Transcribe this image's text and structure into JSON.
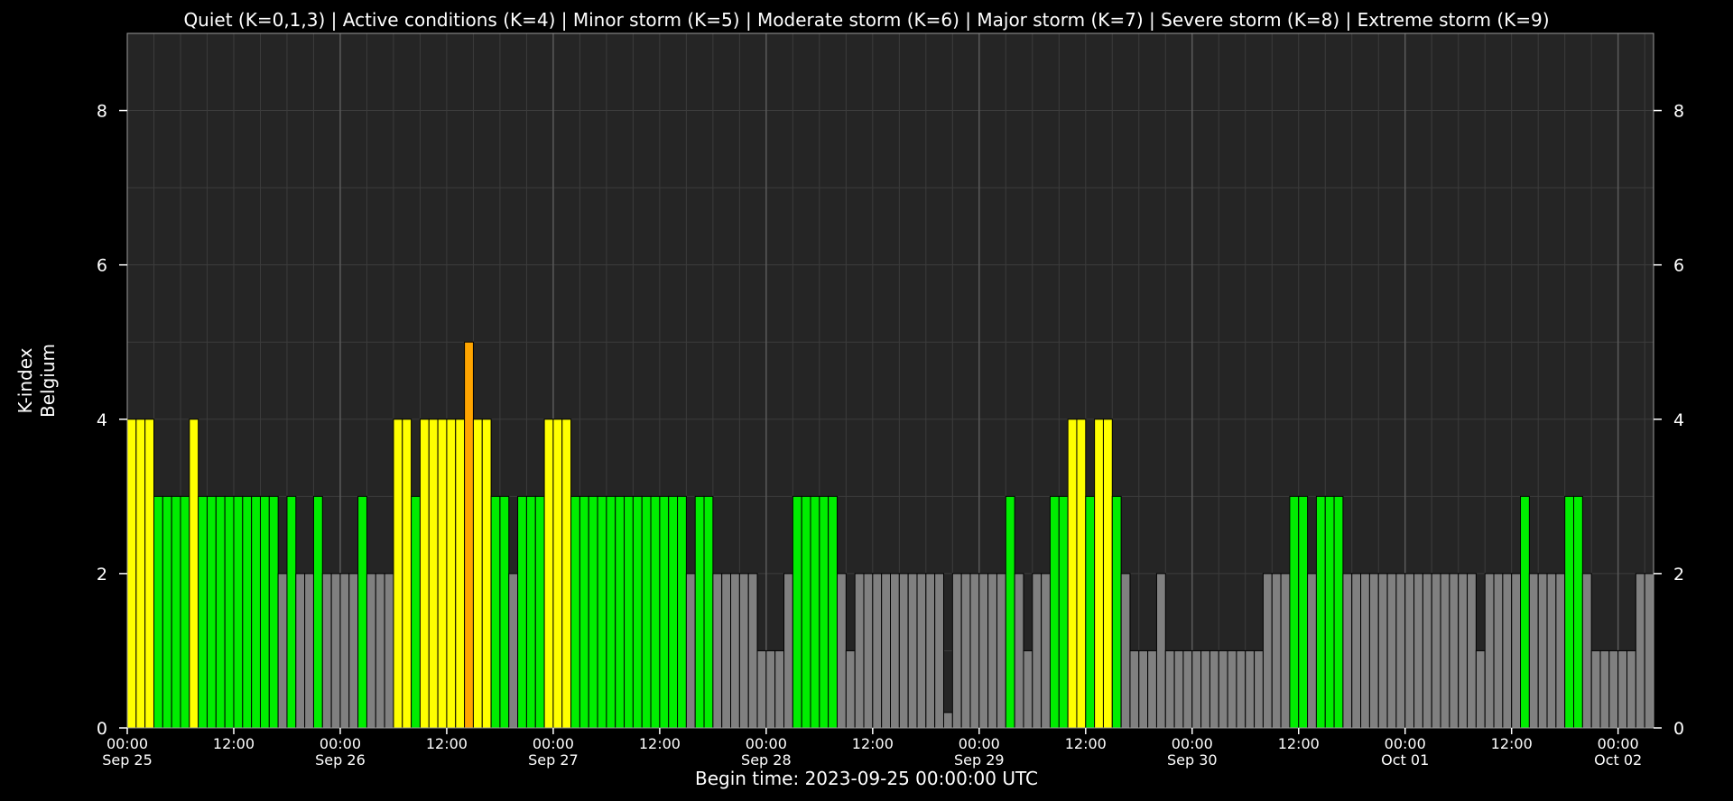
{
  "colors": {
    "background": "#000000",
    "plot_background": "#252525",
    "grid": "#3c3c3c",
    "day_line": "#5a5a5a",
    "quiet": "#808080",
    "quiet_k3": "#00ee00",
    "active": "#ffff00",
    "minor_storm": "#ffa500",
    "bar_edge": "#000000"
  },
  "chart_data": {
    "type": "bar",
    "title": "Quiet (K=0,1,3) | Active conditions (K=4) | Minor storm (K=5) | Moderate storm (K=6) | Major storm (K=7) | Severe storm (K=8) | Extreme storm (K=9)",
    "ylabel_line1": "K-index",
    "ylabel_line2": "Belgium",
    "xlabel": "Begin time: 2023-09-25 00:00:00 UTC",
    "ylim": [
      0,
      9
    ],
    "yticks": [
      0,
      2,
      4,
      6,
      8
    ],
    "interval": "1 hour",
    "x_range": [
      "2023-09-25 00:00",
      "2023-10-02 00:00"
    ],
    "grid": true,
    "xticks": [
      {
        "time": "00:00",
        "date": "Sep 25"
      },
      {
        "time": "12:00",
        "date": ""
      },
      {
        "time": "00:00",
        "date": "Sep 26"
      },
      {
        "time": "12:00",
        "date": ""
      },
      {
        "time": "00:00",
        "date": "Sep 27"
      },
      {
        "time": "12:00",
        "date": ""
      },
      {
        "time": "00:00",
        "date": "Sep 28"
      },
      {
        "time": "12:00",
        "date": ""
      },
      {
        "time": "00:00",
        "date": "Sep 29"
      },
      {
        "time": "12:00",
        "date": ""
      },
      {
        "time": "00:00",
        "date": "Sep 30"
      },
      {
        "time": "12:00",
        "date": ""
      },
      {
        "time": "00:00",
        "date": "Oct 01"
      },
      {
        "time": "12:00",
        "date": ""
      },
      {
        "time": "00:00",
        "date": "Oct 02"
      }
    ],
    "values": [
      4,
      4,
      4,
      3,
      3,
      3,
      3,
      4,
      3,
      3,
      3,
      3,
      3,
      3,
      3,
      3,
      3,
      2,
      3,
      2,
      2,
      3,
      2,
      2,
      2,
      2,
      3,
      2,
      2,
      2,
      4,
      4,
      3,
      4,
      4,
      4,
      4,
      4,
      5,
      4,
      4,
      3,
      3,
      2,
      3,
      3,
      3,
      4,
      4,
      4,
      3,
      3,
      3,
      3,
      3,
      3,
      3,
      3,
      3,
      3,
      3,
      3,
      3,
      2,
      3,
      3,
      2,
      2,
      2,
      2,
      2,
      1,
      1,
      1,
      2,
      3,
      3,
      3,
      3,
      3,
      2,
      1,
      2,
      2,
      2,
      2,
      2,
      2,
      2,
      2,
      2,
      2,
      0.2,
      2,
      2,
      2,
      2,
      2,
      2,
      3,
      2,
      1,
      2,
      2,
      3,
      3,
      4,
      4,
      3,
      4,
      4,
      3,
      2,
      1,
      1,
      1,
      2,
      1,
      1,
      1,
      1,
      1,
      1,
      1,
      1,
      1,
      1,
      1,
      2,
      2,
      2,
      3,
      3,
      2,
      3,
      3,
      3,
      2,
      2,
      2,
      2,
      2,
      2,
      2,
      2,
      2,
      2,
      2,
      2,
      2,
      2,
      2,
      1,
      2,
      2,
      2,
      2,
      3,
      2,
      2,
      2,
      2,
      3,
      3,
      2,
      1,
      1,
      1,
      1,
      1,
      2,
      2
    ]
  }
}
